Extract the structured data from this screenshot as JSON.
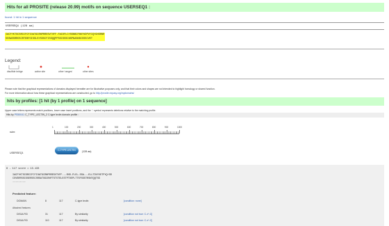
{
  "header": {
    "title": "Hits for all PROSITE (release 20.99) motifs on sequence USERSEQ1 :"
  },
  "found_link": "found: 1 hit in 1 sequence",
  "sequence": {
    "label": "USERSEQ1 (128 aa)",
    "line1": "IACFYKTSCSRCCFCFIOATGCRNPRRESVTVFF.FAIDFLCYSSNBCFNKYVDPVYIQYGHSRNR",
    "line2": "SSSWSSRROSCRTEBFOISSLSYSSSCFISSQQPPSSCSSSCNSPNASKBCSSSCVET"
  },
  "legend": {
    "title": "Legend:",
    "items": [
      {
        "label": "disulfide bridge"
      },
      {
        "label": "active site"
      },
      {
        "label": "other 'ranges'"
      },
      {
        "label": "other sites"
      }
    ]
  },
  "note": {
    "line1": "Please note that the graphical representations of domains displayed hereafter are for illustrative purposes only, and that their colors and shapes are not intended to highlight homology or shared function.",
    "line2_prefix": "For more information about how these graphical representations are constructed, go to",
    "link": "http://prosite.expasy.org/mydomains/"
  },
  "profiles": {
    "title": "hits by profiles: [1 hit (by 1 profile) on 1 sequence]",
    "subtitle": "Upper case letters represents match positions, lower case insert positions, and the '-' symbol represents deletions relative to the matching profile.",
    "hits_prefix": "Hits by",
    "profile_id": "PS50041",
    "profile_name": "C_TYPE_LECTIN_2",
    "profile_desc": "C-type lectin domain profile :"
  },
  "ruler": {
    "label": "ruler:",
    "ticks": [
      "1",
      "100",
      "200",
      "300",
      "400",
      "500",
      "600",
      "700",
      "800",
      "900",
      "1000"
    ]
  },
  "user_track": {
    "label": "USERSEQ1",
    "domain_label": "C-TYPE LECTIN",
    "length": "(128 aa)"
  },
  "detail": {
    "score_line": "8 - 117       score = 13.133",
    "align1": "IACFYKTSCSRCCFCFIOATGCRNPRRESVTVFF.--RVD-FLEL-SSA---ELLTDVYVDTPYQ+SR",
    "align2": "CSVSRRSSCSSERSSCSRSATSGCRNFTSTSTELESTPTOEPLTTSFSSSTRSNTQQTSS",
    "dashes": "---------",
    "predicted_feature": "Predicted feature:",
    "rows": [
      {
        "type": "DOMAIN",
        "from": "8",
        "to": "117",
        "desc": "C-type lectin",
        "condition": "[condition: none]"
      }
    ],
    "attached_features": "Attached features",
    "feature_rows": [
      {
        "type": "DISULFID",
        "from": "31",
        "to": "117",
        "desc": "By similarity",
        "condition": "[condition not true: C-x*-C]"
      },
      {
        "type": "DISULFID",
        "from": "110",
        "to": "117",
        "desc": "By similarity",
        "condition": "[condition not true: C-x*-C]"
      }
    ]
  },
  "colors": {
    "header_bg": "#ccffcc",
    "highlight": "#ffff33",
    "link": "#2a5db0",
    "domain_blue": "#2f7fc1",
    "active_site": "#e0342b",
    "other_sites": "#e0342b",
    "other_ranges": "#6c6"
  }
}
